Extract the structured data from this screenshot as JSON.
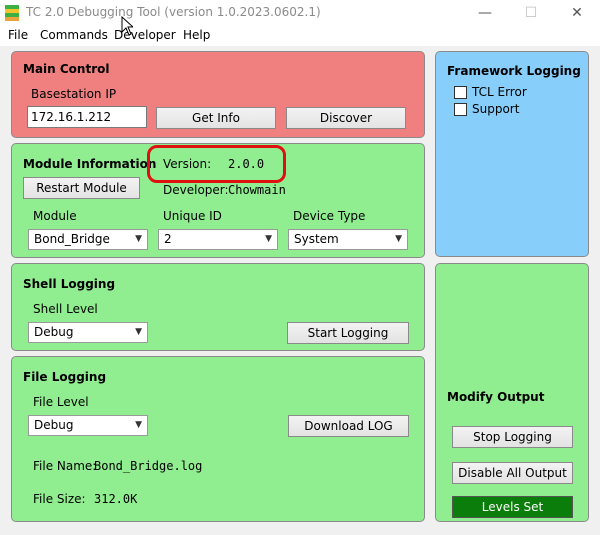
{
  "window": {
    "title": "TC 2.0 Debugging Tool (version 1.0.2023.0602.1)",
    "minimize": "—",
    "maximize": "☐",
    "close": "✕"
  },
  "menu": {
    "items": [
      "File",
      "Commands",
      "Developer",
      "Help"
    ]
  },
  "main_control": {
    "title": "Main Control",
    "ip_label": "Basestation IP",
    "ip_value": "172.16.1.212",
    "get_info": "Get Info",
    "discover": "Discover"
  },
  "module_info": {
    "title": "Module Information",
    "restart": "Restart Module",
    "version_label": "Version:",
    "version_value": "2.0.0",
    "developer_label": "Developer:",
    "developer_value": "Chowmain",
    "module_label": "Module",
    "module_value": "Bond_Bridge",
    "unique_id_label": "Unique ID",
    "unique_id_value": "2",
    "device_type_label": "Device Type",
    "device_type_value": "System"
  },
  "shell_logging": {
    "title": "Shell Logging",
    "level_label": "Shell Level",
    "level_value": "Debug",
    "start": "Start Logging"
  },
  "file_logging": {
    "title": "File Logging",
    "level_label": "File Level",
    "level_value": "Debug",
    "download": "Download LOG",
    "file_name_label": "File Name:",
    "file_name_value": "Bond_Bridge.log",
    "file_size_label": "File Size:",
    "file_size_value": "312.0K"
  },
  "framework_logging": {
    "title": "Framework Logging",
    "tcl_error": "TCL Error",
    "support": "Support"
  },
  "modify_output": {
    "title": "Modify Output",
    "stop": "Stop Logging",
    "disable_all": "Disable All Output",
    "levels_set": "Levels Set"
  },
  "colors": {
    "main_control_bg": "#f08080",
    "section_bg": "#90ee90",
    "framework_bg": "#87cefa",
    "levels_set_bg": "#0a7d0a",
    "highlight": "#e01010"
  }
}
